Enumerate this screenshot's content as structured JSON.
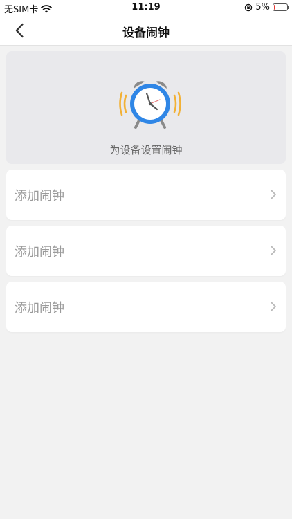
{
  "status_bar": {
    "carrier": "无SIM卡",
    "time": "11:19",
    "battery_percent_label": "5%",
    "battery_level": 0.05
  },
  "nav": {
    "title": "设备闹钟"
  },
  "hero": {
    "caption": "为设备设置闹钟"
  },
  "alarms": [
    {
      "label": "添加闹钟"
    },
    {
      "label": "添加闹钟"
    },
    {
      "label": "添加闹钟"
    }
  ],
  "colors": {
    "accent_blue": "#2f86e6",
    "alarm_ring_yellow": "#f2b136",
    "battery_low": "#e53935"
  }
}
